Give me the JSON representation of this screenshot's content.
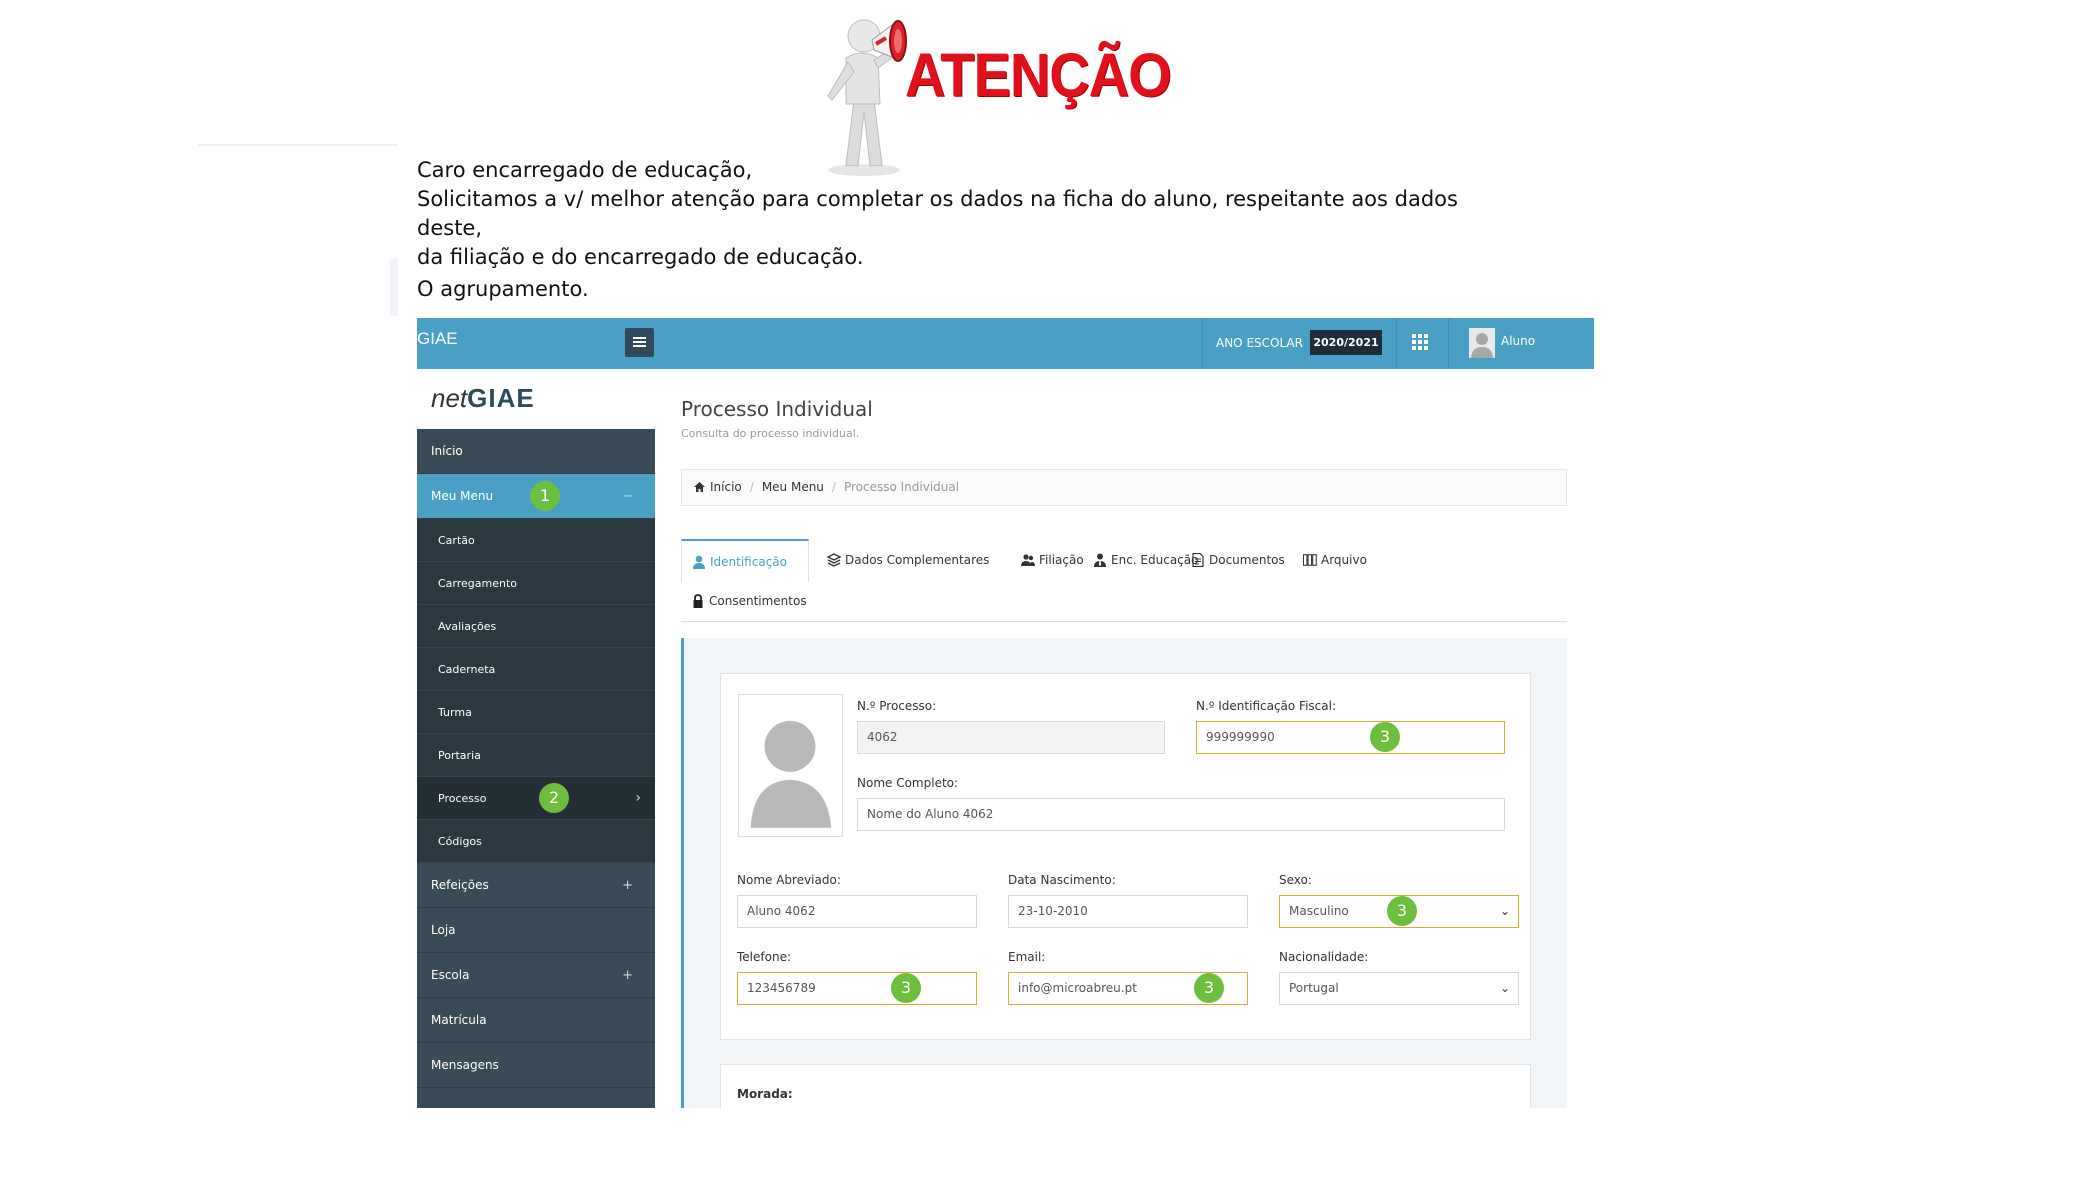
{
  "notice": {
    "title": "ATENÇÃO",
    "lines": [
      "Caro encarregado de educação,",
      "Solicitamos a v/ melhor atenção para completar os dados na ficha do aluno, respeitante aos dados deste,",
      "da filiação e do encarregado de educação.",
      "O agrupamento."
    ]
  },
  "topbar": {
    "brand": "GIAE",
    "ano_label": "ANO ESCOLAR",
    "ano_value": "2020/2021",
    "user": "Aluno"
  },
  "logo": {
    "prefix": "net",
    "name": "GIAE"
  },
  "menu": {
    "inicio": "Início",
    "meu_menu": "Meu Menu",
    "meu_menu_toggle": "−",
    "sub": [
      "Cartão",
      "Carregamento",
      "Avaliações",
      "Caderneta",
      "Turma",
      "Portaria",
      "Processo",
      "Códigos"
    ],
    "refeicoes": "Refeições",
    "loja": "Loja",
    "escola": "Escola",
    "matricula": "Matrícula",
    "mensagens": "Mensagens",
    "plus": "+"
  },
  "badges": {
    "one": "1",
    "two": "2",
    "three": "3"
  },
  "page": {
    "title": "Processo Individual",
    "subtitle": "Consulta do processo individual."
  },
  "breadcrumb": {
    "home": "Início",
    "menu": "Meu Menu",
    "current": "Processo Individual",
    "sep": "/"
  },
  "tabs": [
    "Identificação",
    "Dados Complementares",
    "Filiação",
    "Enc. Educação",
    "Documentos",
    "Arquivo",
    "Consentimentos"
  ],
  "form": {
    "processo_label": "N.º Processo:",
    "processo_value": "4062",
    "nif_label": "N.º Identificação Fiscal:",
    "nif_value": "999999990",
    "nome_label": "Nome Completo:",
    "nome_value": "Nome do Aluno 4062",
    "abrev_label": "Nome Abreviado:",
    "abrev_value": "Aluno 4062",
    "nasc_label": "Data Nascimento:",
    "nasc_value": "23-10-2010",
    "sexo_label": "Sexo:",
    "sexo_value": "Masculino",
    "tel_label": "Telefone:",
    "tel_value": "123456789",
    "email_label": "Email:",
    "email_value": "info@microabreu.pt",
    "nac_label": "Nacionalidade:",
    "nac_value": "Portugal",
    "morada_label": "Morada:"
  },
  "colors": {
    "topbar": "#4a9fc4",
    "sidebar": "#394b56",
    "submenu": "#2b3840",
    "badge": "#6cbe3f",
    "highlight": "#e0a82e",
    "alert": "#e0101c"
  }
}
